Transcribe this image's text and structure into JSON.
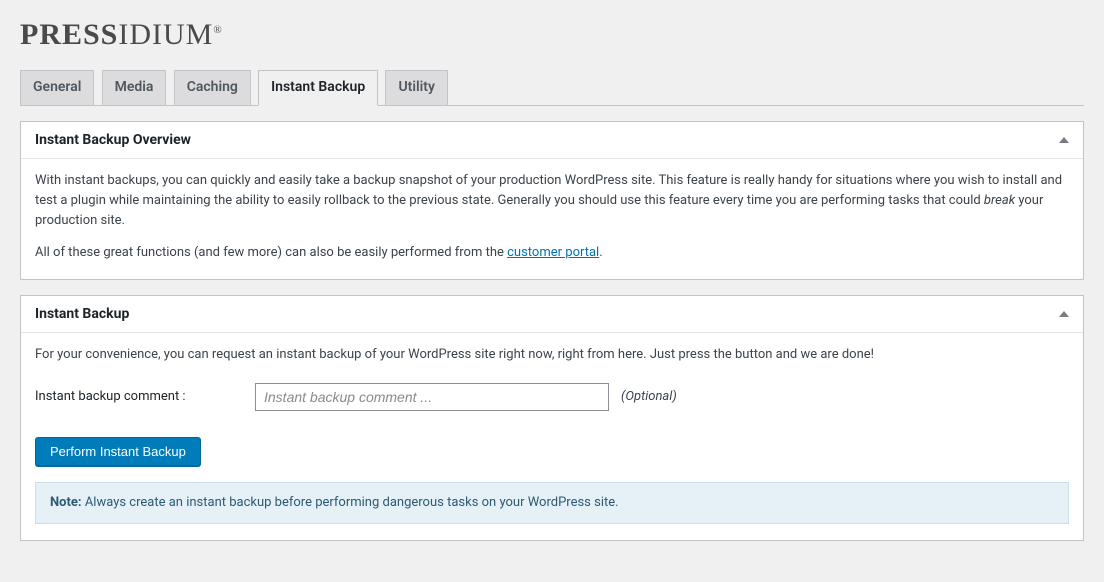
{
  "brand": {
    "bold": "PRESS",
    "thin": "IDIUM"
  },
  "tabs": {
    "general": "General",
    "media": "Media",
    "caching": "Caching",
    "instant_backup": "Instant Backup",
    "utility": "Utility"
  },
  "overview": {
    "title": "Instant Backup Overview",
    "p1a": "With instant backups, you can quickly and easily take a backup snapshot of your production WordPress site. This feature is really handy for situations where you wish to install and test a plugin while maintaining the ability to easily rollback to the previous state. Generally you should use this feature every time you are performing tasks that could ",
    "p1b_italic": "break",
    "p1c": " your production site.",
    "p2a": "All of these great functions (and few more) can also be easily performed from the ",
    "p2_link": "customer portal",
    "p2b": "."
  },
  "backup": {
    "title": "Instant Backup",
    "intro": "For your convenience, you can request an instant backup of your WordPress site right now, right from here. Just press the button and we are done!",
    "comment_label": "Instant backup comment :",
    "comment_placeholder": "Instant backup comment ...",
    "optional": "(Optional)",
    "button": "Perform Instant Backup",
    "note_prefix": "Note:",
    "note_text": " Always create an instant backup before performing dangerous tasks on your WordPress site."
  }
}
